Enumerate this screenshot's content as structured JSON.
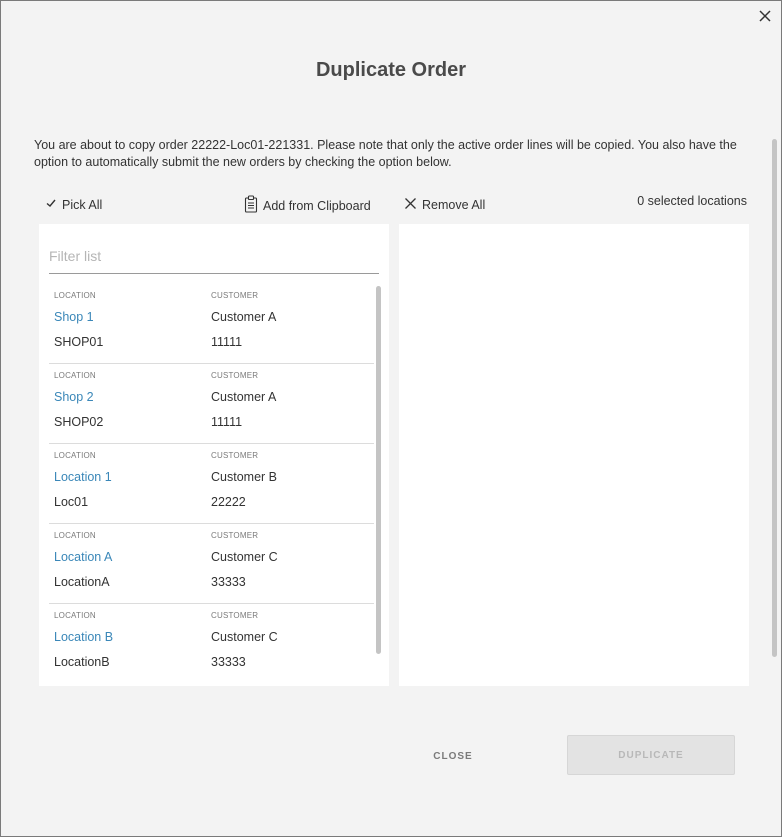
{
  "dialog": {
    "title": "Duplicate Order",
    "description": "You are about to copy order 22222-Loc01-221331. Please note that only the active order lines will be copied. You also have the option to automatically submit the new orders by checking the option below.",
    "close_icon": "close-icon"
  },
  "toolbar": {
    "pick_all": "Pick All",
    "pick_all_icon": "checkmark-icon",
    "add_from_clipboard": "Add from Clipboard",
    "clipboard_icon": "clipboard-icon",
    "remove_all": "Remove All",
    "remove_icon": "x-icon",
    "selected_count": "0 selected locations"
  },
  "filter": {
    "placeholder": "Filter list",
    "value": ""
  },
  "list": {
    "location_header": "LOCATION",
    "customer_header": "CUSTOMER",
    "items": [
      {
        "location_name": "Shop 1",
        "location_code": "SHOP01",
        "customer_name": "Customer A",
        "customer_code": "11111"
      },
      {
        "location_name": "Shop 2",
        "location_code": "SHOP02",
        "customer_name": "Customer A",
        "customer_code": "11111"
      },
      {
        "location_name": "Location 1",
        "location_code": "Loc01",
        "customer_name": "Customer B",
        "customer_code": "22222"
      },
      {
        "location_name": "Location A",
        "location_code": "LocationA",
        "customer_name": "Customer C",
        "customer_code": "33333"
      },
      {
        "location_name": "Location B",
        "location_code": "LocationB",
        "customer_name": "Customer C",
        "customer_code": "33333"
      }
    ]
  },
  "footer": {
    "close_label": "CLOSE",
    "duplicate_label": "DUPLICATE"
  },
  "colors": {
    "link_blue": "#3a87b8",
    "dialog_bg": "#f3f3f3",
    "disabled_button": "#e3e3e3"
  }
}
